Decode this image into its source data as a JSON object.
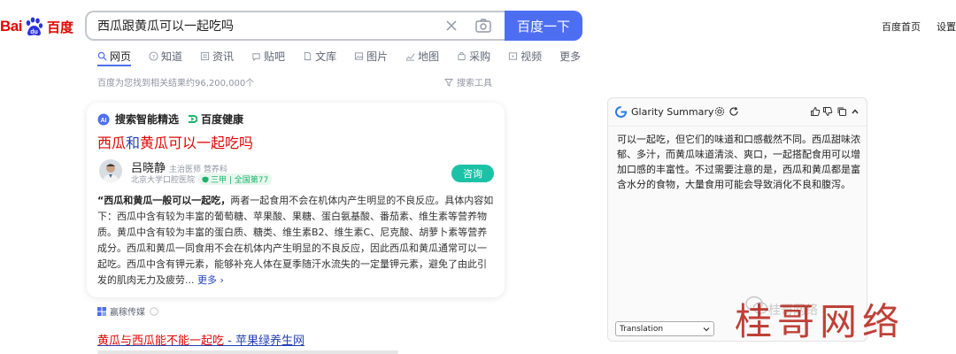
{
  "logo": {
    "bai": "Bai",
    "du": "du",
    "cn": "百度"
  },
  "search": {
    "query": "西瓜跟黄瓜可以一起吃吗",
    "button": "百度一下"
  },
  "top_links": [
    "百度首页",
    "设置"
  ],
  "tabs": [
    {
      "label": "网页",
      "icon": "search-icon"
    },
    {
      "label": "知道",
      "icon": "question-icon"
    },
    {
      "label": "资讯",
      "icon": "news-icon"
    },
    {
      "label": "贴吧",
      "icon": "tieba-icon"
    },
    {
      "label": "文库",
      "icon": "doc-icon"
    },
    {
      "label": "图片",
      "icon": "image-icon"
    },
    {
      "label": "地图",
      "icon": "map-icon"
    },
    {
      "label": "采购",
      "icon": "cart-icon"
    },
    {
      "label": "视频",
      "icon": "video-icon"
    },
    {
      "label": "更多",
      "icon": ""
    }
  ],
  "result_count": "百度为您找到相关结果约96,200,000个",
  "search_tools": "搜索工具",
  "card": {
    "head_ai": "搜索智能精选",
    "head_health": "百度健康",
    "title_a": "西瓜",
    "title_b": "和",
    "title_c": "黄瓜可以一起吃吗",
    "doctor_name": "吕晓静",
    "doctor_title": "主治医师 营养科",
    "hospital": "北京大学口腔医院",
    "grade": "三甲 | 全国第77",
    "consult": "咨询",
    "body_bold": "“西瓜和黄瓜一般可以一起吃，",
    "body_rest": "两者一起食用不会在机体内产生明显的不良反应。具体内容如下：西瓜中含有较为丰富的葡萄糖、苹果酸、果糖、蛋白氨基酸、番茄素、维生素等营养物质。黄瓜中含有较为丰富的蛋白质、糖类、维生素B2、维生素C、尼克酸、胡萝卜素等营养成分。西瓜和黄瓜一同食用不会在机体内产生明显的不良反应，因此西瓜和黄瓜通常可以一起吃。西瓜中含有钾元素，能够补充人体在夏季随汗水流失的一定量钾元素，避免了由此引发的肌肉无力及疲劳...",
    "more": "更多"
  },
  "source": "赢稼传媒",
  "result2": {
    "hl": "黄瓜与西瓜能不能一起吃",
    "rest": " - 苹果绿养生网"
  },
  "glarity": {
    "title": "Glarity Summary",
    "text": "可以一起吃，但它们的味道和口感截然不同。西瓜甜味浓郁、多汁，而黄瓜味道清淡、爽口，一起搭配食用可以增加口感的丰富性。不过需要注意的是，西瓜和黄瓜都是富含水分的食物，大量食用可能会导致消化不良和腹泻。",
    "translate": "Translation"
  },
  "watermark": {
    "small": "桂哥网络",
    "big": "桂哥网络"
  },
  "colors": {
    "baidu_red": "#e10602",
    "baidu_blue": "#4e6ef2",
    "link_blue": "#2440b3",
    "consult_green": "#1cc2a6"
  }
}
